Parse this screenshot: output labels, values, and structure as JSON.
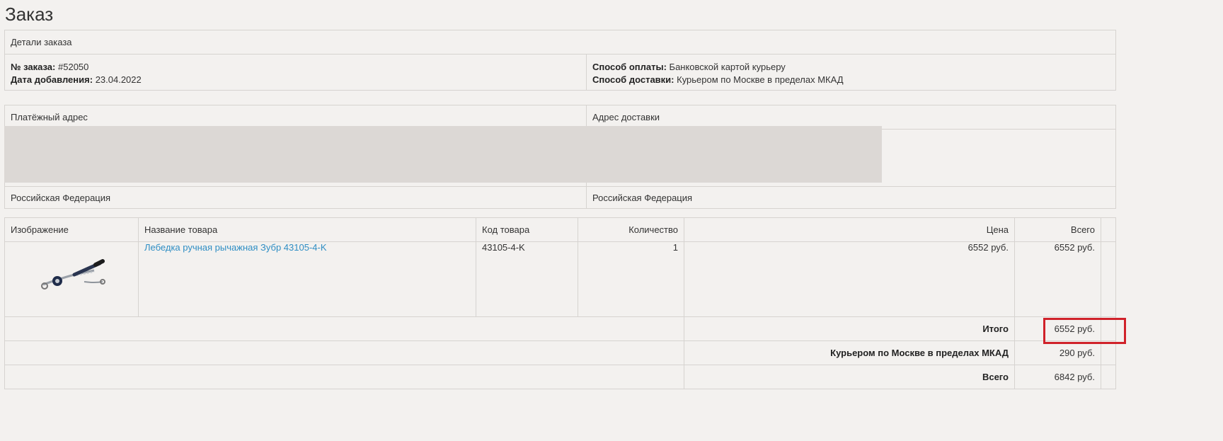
{
  "page_title": "Заказ",
  "order_details": {
    "header": "Детали заказа",
    "order_no_label": "№ заказа:",
    "order_no": "#52050",
    "date_label": "Дата добавления:",
    "date": "23.04.2022",
    "payment_label": "Способ оплаты:",
    "payment": "Банковской картой курьеру",
    "delivery_label": "Способ доставки:",
    "delivery": "Курьером по Москве в пределах МКАД"
  },
  "addresses": {
    "payment_header": "Платёжный адрес",
    "shipping_header": "Адрес доставки",
    "payment_country": "Российская Федерация",
    "shipping_country": "Российская Федерация"
  },
  "products": {
    "columns": [
      "Изображение",
      "Название товара",
      "Код товара",
      "Количество",
      "Цена",
      "Всего"
    ],
    "items": [
      {
        "image_icon": "winch-image",
        "name": "Лебедка ручная рычажная Зубр 43105-4-K",
        "code": "43105-4-K",
        "quantity": "1",
        "price": "6552 руб.",
        "total": "6552 руб."
      }
    ],
    "totals": [
      {
        "label": "Итого",
        "value": "6552 руб."
      },
      {
        "label": "Курьером по Москве в пределах МКАД",
        "value": "290 руб."
      },
      {
        "label": "Всего",
        "value": "6842 руб."
      }
    ]
  },
  "colors": {
    "background": "#f3f1ef",
    "link": "#2f8ec4",
    "highlight": "#d0222a",
    "redaction": "#dcd8d5"
  }
}
